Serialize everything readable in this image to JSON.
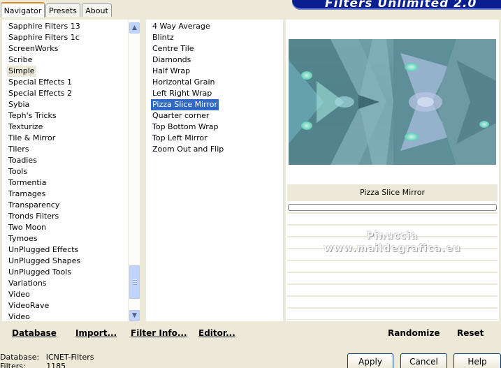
{
  "window": {
    "title": "Filters Unlimited 2.0"
  },
  "tabs": [
    {
      "label": "Navigator",
      "active": true
    },
    {
      "label": "Presets",
      "active": false
    },
    {
      "label": "About",
      "active": false
    }
  ],
  "categories": {
    "items": [
      "Sapphire Filters 13",
      "Sapphire Filters 1c",
      "ScreenWorks",
      "Scribe",
      "Simple",
      "Special Effects 1",
      "Special Effects 2",
      "Sybia",
      "Teph's Tricks",
      "Texturize",
      "Tile & Mirror",
      "Tilers",
      "Toadies",
      "Tools",
      "Tormentia",
      "Tramages",
      "Transparency",
      "Tronds Filters",
      "Two Moon",
      "Tymoes",
      "UnPlugged Effects",
      "UnPlugged Shapes",
      "UnPlugged Tools",
      "Variations",
      "Video",
      "VideoRave",
      "Video"
    ],
    "selected": "Simple"
  },
  "filters": {
    "items": [
      "4 Way Average",
      "Blintz",
      "Centre Tile",
      "Diamonds",
      "Half Wrap",
      "Horizontal Grain",
      "Left Right Wrap",
      "Pizza Slice Mirror",
      "Quarter corner",
      "Top Bottom Wrap",
      "Top Left Mirror",
      "Zoom Out and Flip"
    ],
    "selected": "Pizza Slice Mirror"
  },
  "preview": {
    "filter_name": "Pizza Slice Mirror",
    "watermark_line1": "Pinuccia",
    "watermark_line2": "www.maildegrafica.eu"
  },
  "toolbar": {
    "database": "Database",
    "import": "Import...",
    "filter_info": "Filter Info...",
    "editor": "Editor...",
    "randomize": "Randomize",
    "reset": "Reset"
  },
  "status": {
    "database_label": "Database:",
    "database_value": "ICNET-Filters",
    "filters_label": "Filters:",
    "filters_value": "1185"
  },
  "dialog_buttons": {
    "apply": "Apply",
    "cancel": "Cancel",
    "help": "Help"
  },
  "colors": {
    "selection": "#316ac5",
    "banner": "#0a1f8f",
    "tab_accent": "#e68b2c"
  }
}
